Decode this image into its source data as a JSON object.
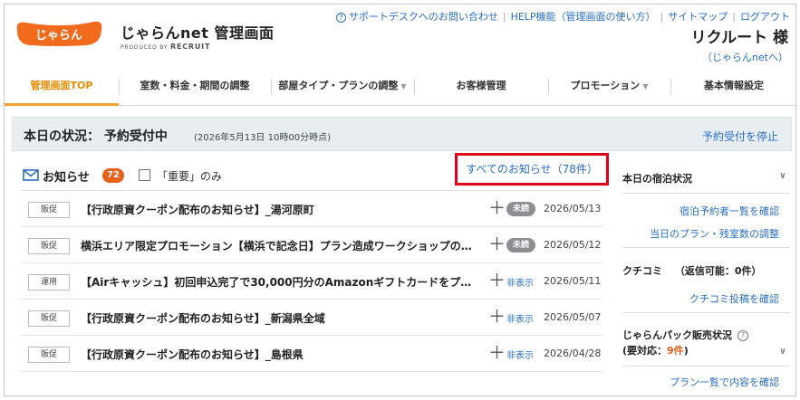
{
  "header": {
    "logo_text": "じゃらん",
    "site_title": "じゃらんnet 管理画面",
    "produced_by": "PRODUCED BY",
    "produced_brand": "RECRUIT",
    "top_links": [
      "サポートデスクへのお問い合わせ",
      "HELP機能（管理画面の使い方）",
      "サイトマップ",
      "ログアウト"
    ],
    "user_name": "リクルート 様",
    "user_link": "（じゃらんnetへ）"
  },
  "nav": {
    "items": [
      {
        "label": "管理画面TOP",
        "active": true
      },
      {
        "label": "室数・料金・期間の調整",
        "active": false
      },
      {
        "label": "部屋タイプ・プランの調整",
        "active": false,
        "dropdown": true
      },
      {
        "label": "お客様管理",
        "active": false
      },
      {
        "label": "プロモーション",
        "active": false,
        "dropdown": true
      },
      {
        "label": "基本情報設定",
        "active": false
      }
    ]
  },
  "status": {
    "title": "本日の状況： 予約受付中",
    "time": "(2026年5月13日 10時00分時点)",
    "stop_link": "予約受付を停止"
  },
  "notices": {
    "title": "お知らせ",
    "count": "72",
    "important_only": "「重要」のみ",
    "all_link": "すべてのお知らせ（78件）",
    "rows": [
      {
        "tag": "販促",
        "title": "【行政原資クーポン配布のお知らせ】_湯河原町",
        "status": "未読",
        "status_type": "unread",
        "date": "2026/05/13"
      },
      {
        "tag": "販促",
        "title": "横浜エリア限定プロモーション【横浜で記念日】プラン造成ワークショップの…",
        "status": "未読",
        "status_type": "unread",
        "date": "2026/05/12"
      },
      {
        "tag": "運用",
        "title": "【Airキャッシュ】初回申込完了で30,000円分のAmazonギフトカードをプ…",
        "status": "非表示",
        "status_type": "hidden",
        "date": "2026/05/11"
      },
      {
        "tag": "販促",
        "title": "【行政原資クーポン配布のお知らせ】_新潟県全域",
        "status": "非表示",
        "status_type": "hidden",
        "date": "2026/05/07"
      },
      {
        "tag": "販促",
        "title": "【行政原資クーポン配布のお知らせ】_島根県",
        "status": "非表示",
        "status_type": "hidden",
        "date": "2026/04/28"
      }
    ]
  },
  "right": {
    "lodging_title": "本日の宿泊状況",
    "lodging_links": [
      "宿泊予約者一覧を確認",
      "当日のプラン・残室数の調整"
    ],
    "kuchikomi_title": "クチコミ",
    "kuchikomi_reply": "（返信可能：0件）",
    "kuchikomi_link": "クチコミ投稿を確認",
    "pack_title": "じゃらんパック販売状況",
    "pack_prefix": "(要対応：",
    "pack_count": "9件",
    "pack_suffix": ")",
    "pack_link": "プラン一覧で内容を確認"
  },
  "colors": {
    "accent_orange": "#e8611a",
    "nav_active": "#e58b00",
    "link_blue": "#2a6fc9",
    "highlight_red": "#e0001c",
    "status_bg": "#e8edf2"
  }
}
